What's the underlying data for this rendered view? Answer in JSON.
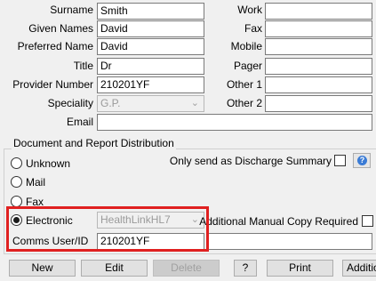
{
  "labels": {
    "surname": "Surname",
    "given_names": "Given Names",
    "preferred_name": "Preferred Name",
    "title": "Title",
    "provider_number": "Provider Number",
    "speciality": "Speciality",
    "email": "Email",
    "work": "Work",
    "fax": "Fax",
    "mobile": "Mobile",
    "pager": "Pager",
    "other1": "Other 1",
    "other2": "Other 2"
  },
  "values": {
    "surname": "Smith",
    "given_names": "David",
    "preferred_name": "David",
    "title": "Dr",
    "provider_number": "210201YF",
    "speciality": "G.P.",
    "email": "",
    "work": "",
    "fax": "",
    "mobile": "",
    "pager": "",
    "other1": "",
    "other2": ""
  },
  "distribution": {
    "group_title": "Document and Report Distribution",
    "options": {
      "unknown": "Unknown",
      "mail": "Mail",
      "fax": "Fax",
      "electronic": "Electronic"
    },
    "selected": "Electronic",
    "electronic_method": "HealthLinkHL7",
    "only_discharge_label": "Only send as Discharge Summary",
    "only_discharge_checked": false,
    "additional_copy_label": "Additional Manual Copy Required",
    "additional_copy_checked": false,
    "comms_label": "Comms User/ID",
    "comms_value": "210201YF",
    "comms_extra_value": "",
    "help_icon_text": "?"
  },
  "buttons": {
    "new": "New",
    "edit": "Edit",
    "delete": "Delete",
    "question": "?",
    "print": "Print",
    "additional": "Additio"
  },
  "colors": {
    "highlight": "#e02020",
    "help_icon": "#3a7bd5"
  }
}
